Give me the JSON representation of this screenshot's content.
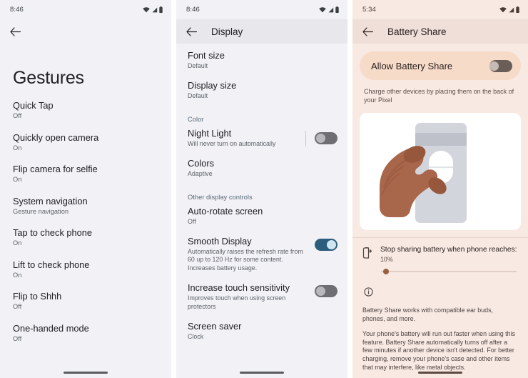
{
  "panels": [
    {
      "id": "gestures",
      "statusbar": {
        "time": "8:46",
        "icons": [
          "wifi-icon",
          "signal-icon",
          "battery-icon"
        ]
      },
      "appbar": {
        "title": "",
        "back": "back-arrow-icon"
      },
      "page_title": "Gestures",
      "items": [
        {
          "title": "Quick Tap",
          "sub": "Off"
        },
        {
          "title": "Quickly open camera",
          "sub": "On"
        },
        {
          "title": "Flip camera for selfie",
          "sub": "On"
        },
        {
          "title": "System navigation",
          "sub": "Gesture navigation"
        },
        {
          "title": "Tap to check phone",
          "sub": "On"
        },
        {
          "title": "Lift to check phone",
          "sub": "On"
        },
        {
          "title": "Flip to Shhh",
          "sub": "Off"
        },
        {
          "title": "One-handed mode",
          "sub": "Off"
        }
      ]
    },
    {
      "id": "display",
      "statusbar": {
        "time": "8:46",
        "icons": [
          "wifi-icon",
          "signal-icon",
          "battery-icon"
        ]
      },
      "appbar": {
        "title": "Display",
        "back": "back-arrow-icon"
      },
      "items": [
        {
          "type": "row",
          "title": "Font size",
          "sub": "Default"
        },
        {
          "type": "row",
          "title": "Display size",
          "sub": "Default"
        },
        {
          "type": "section",
          "title": "Color"
        },
        {
          "type": "toggle",
          "title": "Night Light",
          "sub": "Will never turn on automatically",
          "state": "off",
          "divider": true
        },
        {
          "type": "row",
          "title": "Colors",
          "sub": "Adaptive"
        },
        {
          "type": "section",
          "title": "Other display controls"
        },
        {
          "type": "row",
          "title": "Auto-rotate screen",
          "sub": "Off"
        },
        {
          "type": "toggle",
          "title": "Smooth Display",
          "sub": "Automatically raises the refresh rate from 60 up to 120 Hz for some content. Increases battery usage.",
          "state": "on",
          "divider": false
        },
        {
          "type": "toggle",
          "title": "Increase touch sensitivity",
          "sub": "Improves touch when using screen protectors",
          "state": "off",
          "divider": false
        },
        {
          "type": "row",
          "title": "Screen saver",
          "sub": "Clock"
        }
      ]
    },
    {
      "id": "battery_share",
      "statusbar": {
        "time": "5:34",
        "icons": [
          "wifi-icon",
          "signal-icon",
          "battery-icon"
        ]
      },
      "appbar": {
        "title": "Battery Share",
        "back": "back-arrow-icon"
      },
      "allow": {
        "label": "Allow Battery Share",
        "state": "off"
      },
      "description": "Charge other devices by placing them on the back of your Pixel",
      "illustration": "hand-holding-earbud-case-on-phone-back",
      "stop_sharing": {
        "icon": "battery-share-icon",
        "title": "Stop sharing battery when phone reaches:",
        "value": "10%",
        "slider_percent": 10
      },
      "info_icon": "info-icon",
      "notes": [
        "Battery Share works with compatible ear buds, phones, and more.",
        "Your phone's battery will run out faster when using this feature. Battery Share automatically turns off after a few minutes if another device isn't detected. For better charging, remove your phone's case and other items that may interfere, like metal objects."
      ]
    }
  ],
  "colors": {
    "panel_bg": "#f1f1f6",
    "appbar_gray": "#e7e7ec",
    "warm_bg": "#f8e9e3",
    "warm_appbar": "#f0ded8",
    "allow_card": "#f7dbc9",
    "toggle_on": "#2c5d7c",
    "toggle_off": "#6e6e73",
    "slider_thumb": "#9c5f3c",
    "section_label": "#5a6b78"
  }
}
